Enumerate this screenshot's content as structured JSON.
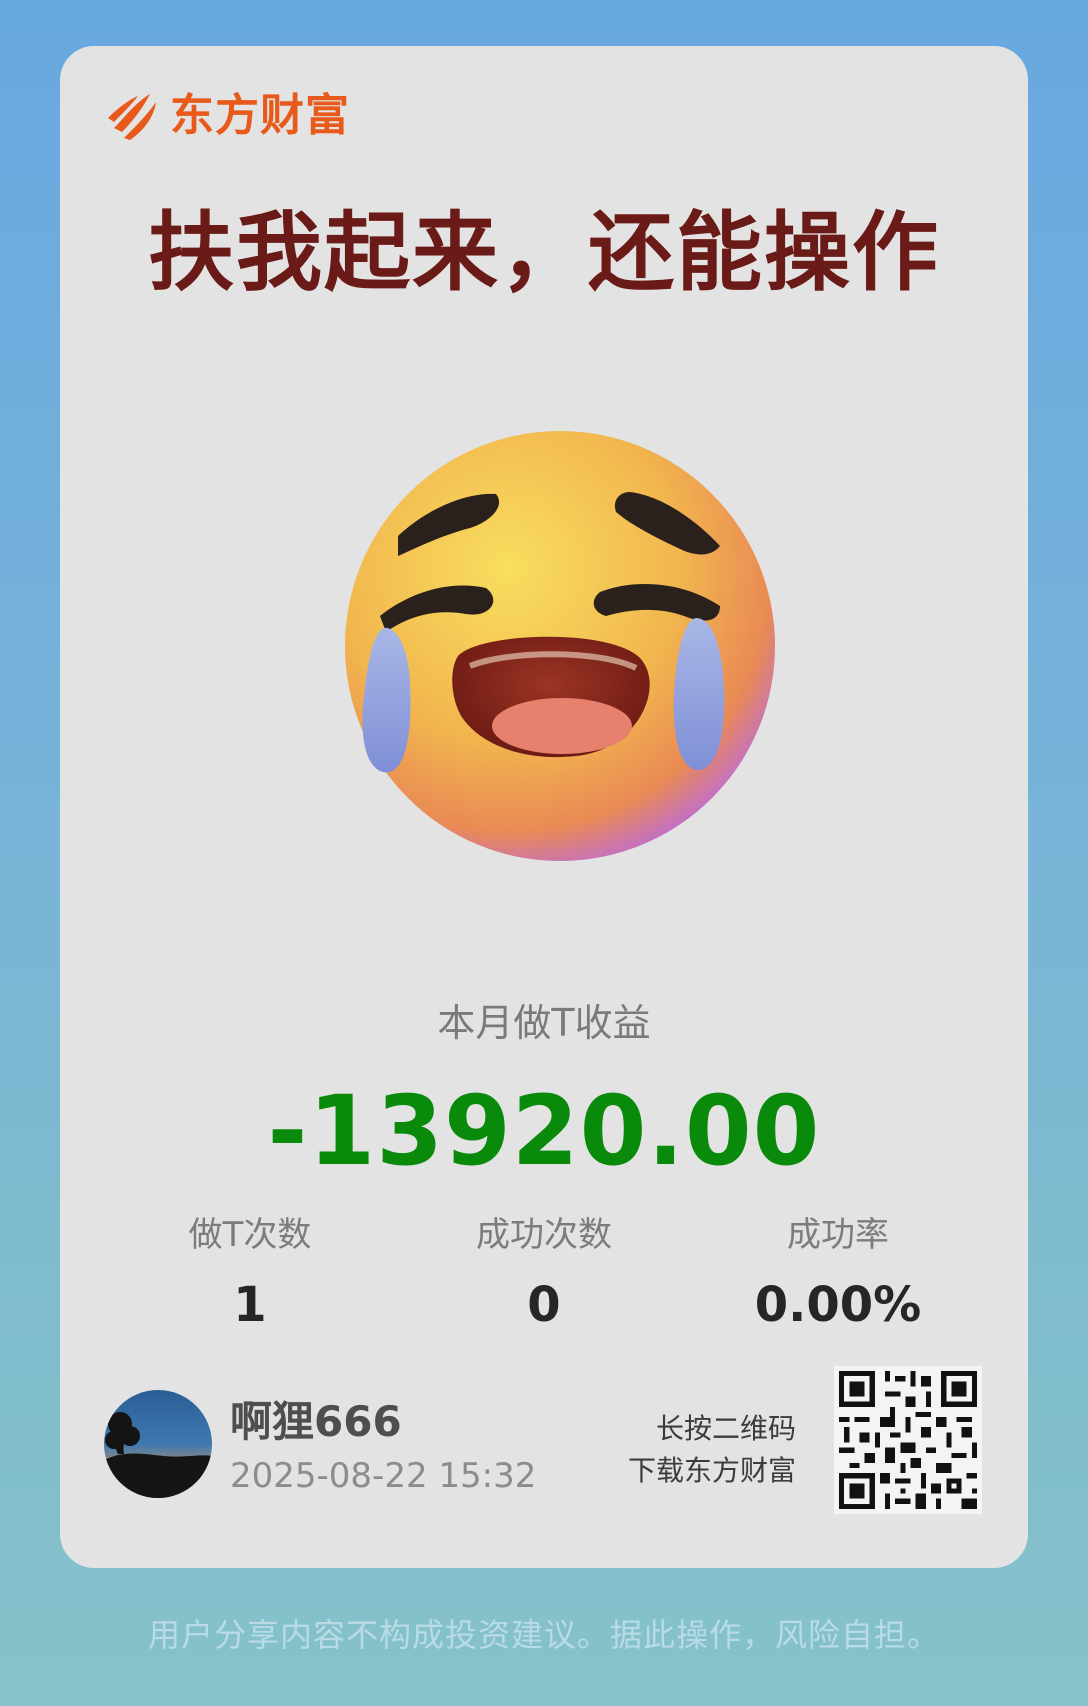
{
  "brand": {
    "name": "东方财富",
    "color": "#e85a1b"
  },
  "headline": "扶我起来，还能操作",
  "emoji": {
    "icon": "loudly-crying-face-icon"
  },
  "profit": {
    "label": "本月做T收益",
    "value": "-13920.00",
    "color": "#0a8a0a"
  },
  "stats": [
    {
      "label": "做T次数",
      "value": "1"
    },
    {
      "label": "成功次数",
      "value": "0"
    },
    {
      "label": "成功率",
      "value": "0.00%"
    }
  ],
  "user": {
    "name": "啊狸666",
    "timestamp": "2025-08-22 15:32"
  },
  "qr": {
    "hint_line1": "长按二维码",
    "hint_line2": "下载东方财富",
    "icon": "qr-code-icon"
  },
  "disclaimer": "用户分享内容不构成投资建议。据此操作，风险自担。",
  "colors": {
    "headline": "#6a1a17",
    "card_bg": "#e3e3e3"
  }
}
